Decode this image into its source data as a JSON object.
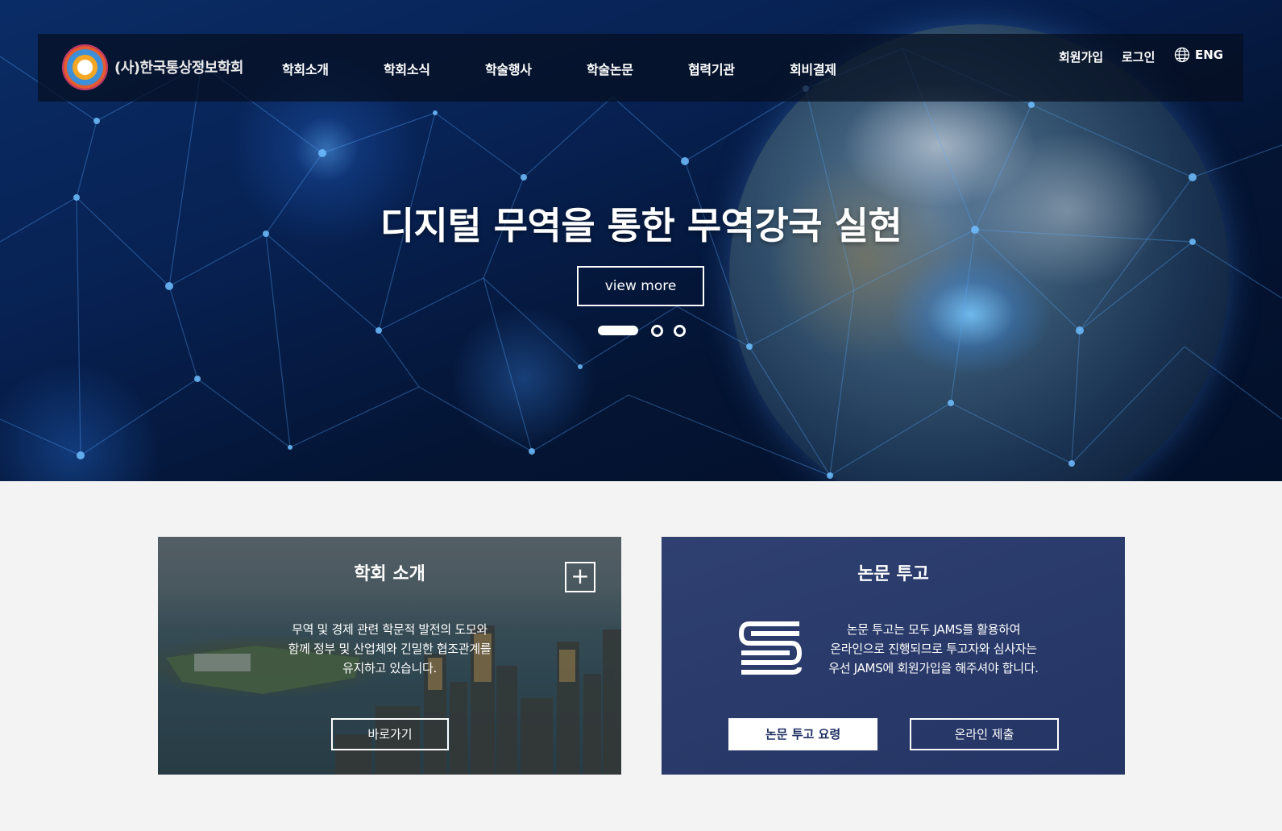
{
  "brand": {
    "logo_text": "(사)한국통상정보학회",
    "logo_icon": "society-emblem-icon"
  },
  "nav": {
    "items": [
      {
        "label": "학회소개"
      },
      {
        "label": "학회소식"
      },
      {
        "label": "학술행사"
      },
      {
        "label": "학술논문"
      },
      {
        "label": "협력기관"
      },
      {
        "label": "회비결제"
      }
    ]
  },
  "utility": {
    "signup": "회원가입",
    "login": "로그인",
    "language": "ENG",
    "language_icon": "globe-icon"
  },
  "hero": {
    "title": "디지털 무역을 통한 무역강국 실현",
    "button": "view more",
    "slides_total": 3,
    "active_slide": 1
  },
  "cards": {
    "about": {
      "title": "학회 소개",
      "plus_icon": "plus-icon",
      "desc_line1": "무역 및 경제 관련 학문적 발전의 도모와",
      "desc_line2": "함께 정부 및 산업체와 긴밀한 협조관계를",
      "desc_line3": "유지하고 있습니다.",
      "button": "바로가기"
    },
    "submission": {
      "title": "논문 투고",
      "icon": "jams-s-icon",
      "desc_line1": "논문 투고는 모두 JAMS를 활용하여",
      "desc_line2": "온라인으로 진행되므로 투고자와 심사자는",
      "desc_line3": "우선 JAMS에 회원가입을 해주셔야 합니다.",
      "button_guide": "논문 투고 요령",
      "button_submit": "온라인 제출"
    }
  },
  "colors": {
    "hero_bg": "#041433",
    "card_blue": "#213368",
    "page_bg": "#f3f3f3"
  }
}
